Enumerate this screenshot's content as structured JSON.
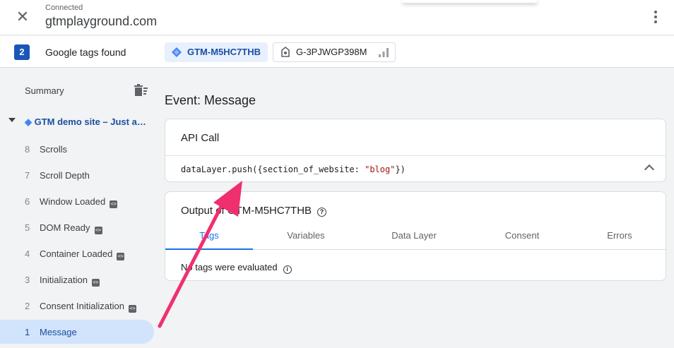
{
  "header": {
    "status": "Connected",
    "site": "gtmplayground.com"
  },
  "tagsbar": {
    "count": "2",
    "label": "Google tags found",
    "gtm_tag": "GTM-M5HC7THB",
    "ga_tag": "G-3PJWGP398M"
  },
  "sidebar": {
    "summary": "Summary",
    "container": "GTM demo site – Just a…",
    "events": [
      {
        "num": "8",
        "label": "Scrolls",
        "code": false
      },
      {
        "num": "7",
        "label": "Scroll Depth",
        "code": false
      },
      {
        "num": "6",
        "label": "Window Loaded",
        "code": true
      },
      {
        "num": "5",
        "label": "DOM Ready",
        "code": true
      },
      {
        "num": "4",
        "label": "Container Loaded",
        "code": true
      },
      {
        "num": "3",
        "label": "Initialization",
        "code": true
      },
      {
        "num": "2",
        "label": "Consent Initialization",
        "code": true
      },
      {
        "num": "1",
        "label": "Message",
        "code": false
      }
    ]
  },
  "main": {
    "title": "Event: Message",
    "api": {
      "title": "API Call",
      "code_prefix": "dataLayer.push({section_of_website: ",
      "code_string": "\"blog\"",
      "code_suffix": "})"
    },
    "output": {
      "title": "Output of GTM-M5HC7THB",
      "tabs": [
        "Tags",
        "Variables",
        "Data Layer",
        "Consent",
        "Errors"
      ],
      "empty": "No tags were evaluated"
    }
  },
  "colors": {
    "accent": "#1a73e8",
    "brand_blue": "#1a4fa1",
    "active_bg": "#d2e3fc",
    "annotation_arrow": "#f0306e"
  }
}
